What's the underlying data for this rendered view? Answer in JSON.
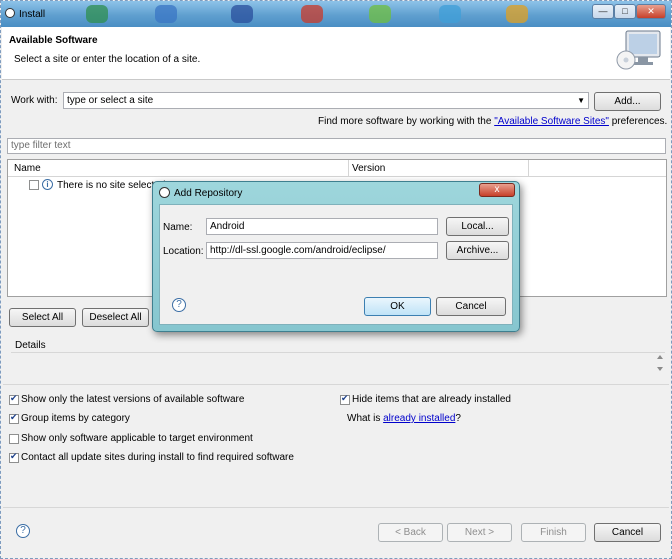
{
  "window": {
    "title": "Install"
  },
  "header": {
    "title": "Available Software",
    "subtitle": "Select a site or enter the location of a site."
  },
  "work_with": {
    "label": "Work with:",
    "placeholder": "type or select a site",
    "add_button": "Add..."
  },
  "find_more": {
    "prefix": "Find more software by working with the ",
    "link": "\"Available Software Sites\"",
    "suffix": " preferences."
  },
  "filter": {
    "placeholder": "type filter text"
  },
  "table": {
    "columns": [
      "Name",
      "Version"
    ],
    "rows": [
      {
        "name": "There is no site selected."
      }
    ]
  },
  "buttons": {
    "select_all": "Select All",
    "deselect_all": "Deselect All"
  },
  "details": {
    "label": "Details"
  },
  "options": {
    "latest_versions": {
      "label": "Show only the latest versions of available software",
      "checked": true
    },
    "group_by_category": {
      "label": "Group items by category",
      "checked": true
    },
    "target_env": {
      "label": "Show only software applicable to target environment",
      "checked": false
    },
    "contact_sites": {
      "label": "Contact all update sites during install to find required software",
      "checked": true
    },
    "hide_installed": {
      "label": "Hide items that are already installed",
      "checked": true
    },
    "what_is_prefix": "What is ",
    "what_is_link": "already installed",
    "what_is_suffix": "?"
  },
  "footer": {
    "back": "< Back",
    "next": "Next >",
    "finish": "Finish",
    "cancel": "Cancel"
  },
  "dialog": {
    "title": "Add Repository",
    "name_label": "Name:",
    "name_value": "Android",
    "location_label": "Location:",
    "location_value": "http://dl-ssl.google.com/android/eclipse/",
    "local_button": "Local...",
    "archive_button": "Archive...",
    "ok": "OK",
    "cancel": "Cancel",
    "close_glyph": "x"
  }
}
